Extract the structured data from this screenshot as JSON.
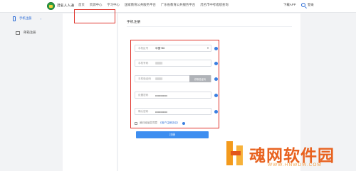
{
  "header": {
    "app_title": "茂名人人通",
    "nav_items": [
      "首页",
      "资源中心",
      "学习中心",
      "国家教育公共服务平台",
      "广东省教育公共服务平台",
      "茂名市中考成绩查询"
    ],
    "download_label": "下载APP",
    "search_icon": "search-icon",
    "login_label": "登录"
  },
  "sidebar": {
    "items": [
      {
        "label": "手机注册",
        "icon": "phone-icon",
        "active": true,
        "chevron": "›"
      },
      {
        "label": "邮箱注册",
        "icon": "mail-icon",
        "active": false
      }
    ]
  },
  "main": {
    "title": "手机注册",
    "form": {
      "country": {
        "label": "手机区号",
        "value": "中国+86"
      },
      "phone": {
        "label": "手机号码",
        "value": ""
      },
      "sms_code": {
        "label": "手机验证码",
        "value": "",
        "button": "获取验证码"
      },
      "password": {
        "label": "设置密码",
        "value": "••••••••••••••"
      },
      "confirm_password": {
        "label": "确认密码",
        "value": "••••••••••••••"
      }
    },
    "agreement": {
      "prefix": "我已阅读并同意",
      "link": "《用户注册协议》"
    },
    "register_label": "注册"
  },
  "watermark": {
    "text": "魂网软件园",
    "sub": "WWW.HNWDW.COM"
  },
  "colors": {
    "accent": "#2a6bd6",
    "primary_button": "#3d8ef0",
    "highlight_border": "#e0342c",
    "watermark": "#e8621f"
  }
}
